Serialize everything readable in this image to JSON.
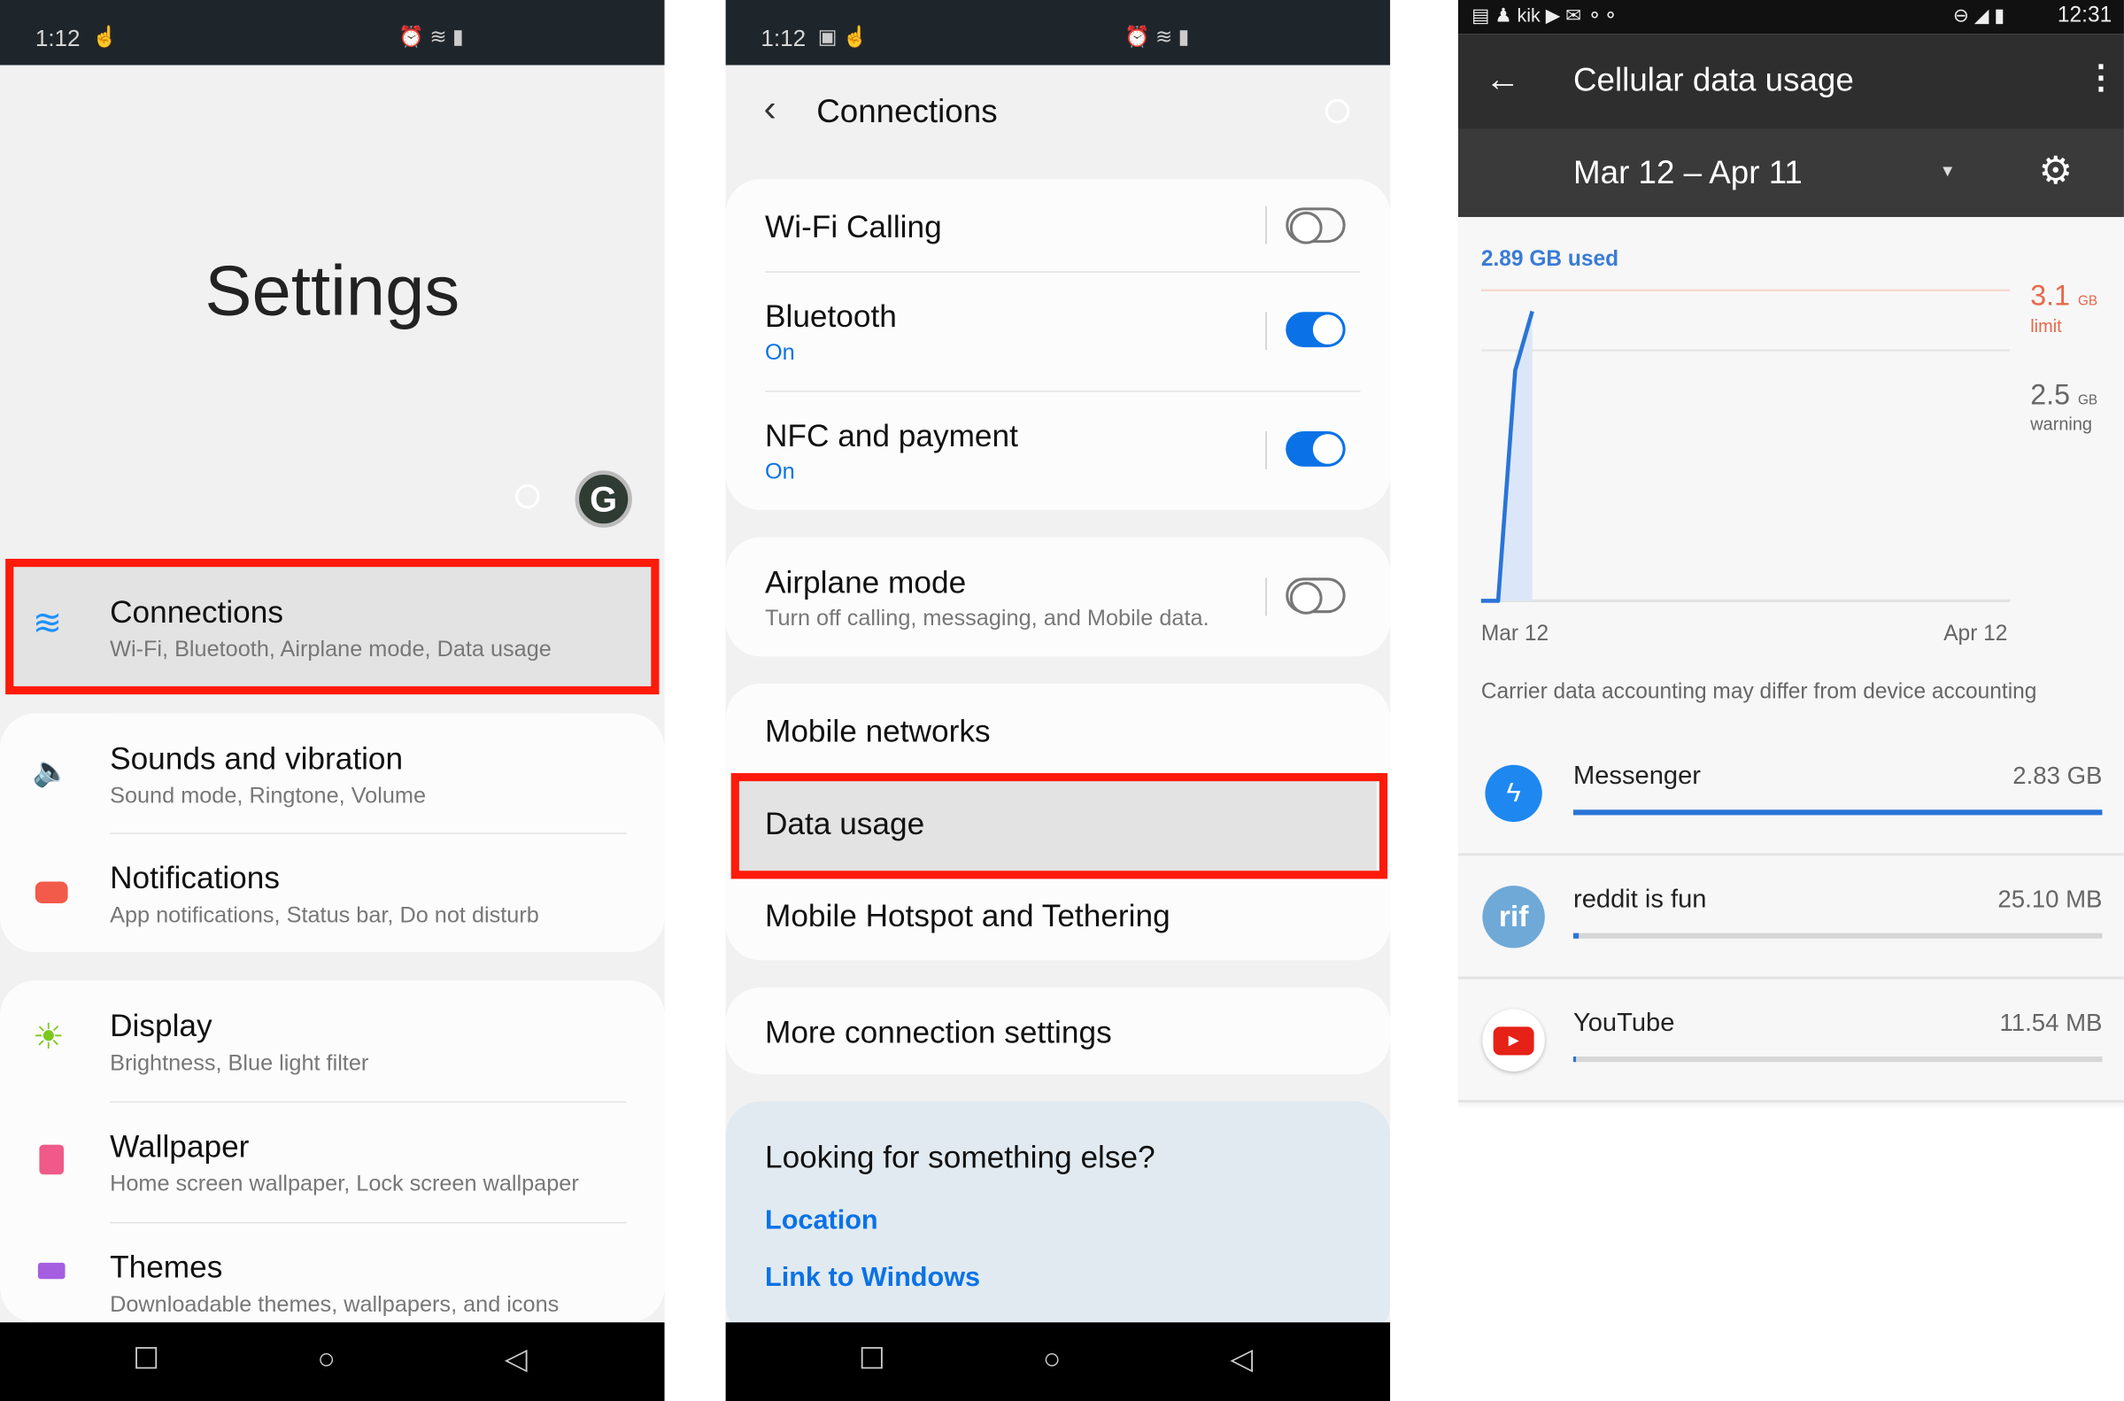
{
  "left": {
    "status": {
      "time": "1:12"
    },
    "title": "Settings",
    "highlighted": {
      "title": "Connections",
      "subtitle": "Wi-Fi, Bluetooth, Airplane mode, Data usage"
    },
    "groups": [
      [
        {
          "title": "Sounds and vibration",
          "subtitle": "Sound mode, Ringtone, Volume",
          "icon": "volume-icon"
        },
        {
          "title": "Notifications",
          "subtitle": "App notifications, Status bar, Do not disturb",
          "icon": "notification-icon"
        }
      ],
      [
        {
          "title": "Display",
          "subtitle": "Brightness, Blue light filter",
          "icon": "brightness-icon"
        },
        {
          "title": "Wallpaper",
          "subtitle": "Home screen wallpaper, Lock screen wallpaper",
          "icon": "wallpaper-icon"
        },
        {
          "title": "Themes",
          "subtitle": "Downloadable themes, wallpapers, and icons",
          "icon": "themes-icon"
        }
      ]
    ]
  },
  "middle": {
    "status": {
      "time": "1:12"
    },
    "header": "Connections",
    "wifi_calling": {
      "title": "Wi-Fi Calling",
      "on": false
    },
    "bluetooth": {
      "title": "Bluetooth",
      "status": "On",
      "on": true
    },
    "nfc": {
      "title": "NFC and payment",
      "status": "On",
      "on": true
    },
    "airplane": {
      "title": "Airplane mode",
      "subtitle": "Turn off calling, messaging, and Mobile data.",
      "on": false
    },
    "mobile_networks": "Mobile networks",
    "data_usage": "Data usage",
    "hotspot": "Mobile Hotspot and Tethering",
    "more": "More connection settings",
    "looking": {
      "title": "Looking for something else?",
      "links": [
        "Location",
        "Link to Windows"
      ]
    }
  },
  "right": {
    "status": {
      "time": "12:31",
      "kik": "kik"
    },
    "title": "Cellular data usage",
    "range": "Mar 12 – Apr 11",
    "used": "2.89 GB used",
    "limit": {
      "value": "3.1",
      "unit": "GB",
      "label": "limit"
    },
    "warning": {
      "value": "2.5",
      "unit": "GB",
      "label": "warning"
    },
    "note": "Carrier data accounting may differ from device accounting",
    "apps": [
      {
        "name": "Messenger",
        "usage": "2.83 GB",
        "fraction": 1.0,
        "icon": "messenger-icon"
      },
      {
        "name": "reddit is fun",
        "usage": "25.10 MB",
        "fraction": 0.009,
        "icon": "reddit-is-fun-icon",
        "badge": "rif"
      },
      {
        "name": "YouTube",
        "usage": "11.54 MB",
        "fraction": 0.004,
        "icon": "youtube-icon"
      }
    ],
    "colors": {
      "accent": "#2a74d8",
      "limit": "#e8674a"
    }
  },
  "chart_data": {
    "type": "line",
    "title": "",
    "xlabel": "",
    "ylabel": "",
    "x_ticks": [
      "Mar 12",
      "Apr 12"
    ],
    "ylim": [
      0,
      3.1
    ],
    "unit": "GB",
    "points": [
      [
        "Mar 12",
        0
      ],
      [
        "Mar 13",
        0
      ],
      [
        "Mar 14",
        2.3
      ],
      [
        "Mar 15",
        2.89
      ]
    ],
    "reference_lines": [
      {
        "value": 3.1,
        "label": "limit"
      },
      {
        "value": 2.5,
        "label": "warning"
      }
    ]
  }
}
